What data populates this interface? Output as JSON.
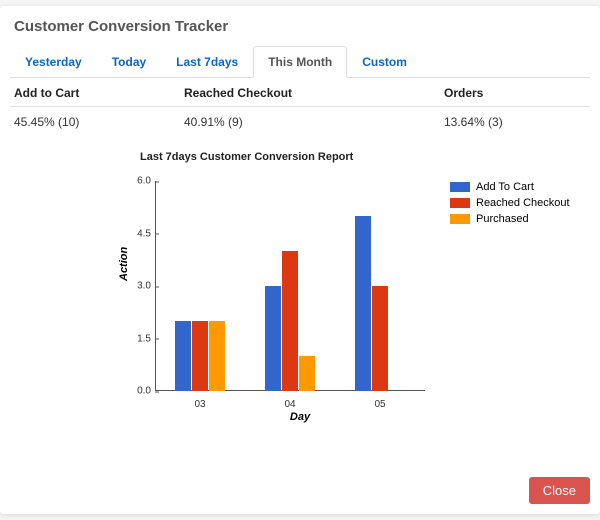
{
  "title": "Customer Conversion Tracker",
  "tabs": [
    "Yesterday",
    "Today",
    "Last 7days",
    "This Month",
    "Custom"
  ],
  "active_tab": 3,
  "metrics": {
    "headers": [
      "Add to Cart",
      "Reached Checkout",
      "Orders"
    ],
    "values": [
      "45.45% (10)",
      "40.91% (9)",
      "13.64% (3)"
    ]
  },
  "legend": [
    "Add To Cart",
    "Reached Checkout",
    "Purchased"
  ],
  "colors": {
    "add": "#3366cc",
    "reach": "#dc3912",
    "buy": "#ff9900",
    "close_btn": "#d9534f"
  },
  "close_label": "Close",
  "chart_data": {
    "type": "bar",
    "title": "Last 7days Customer Conversion Report",
    "xlabel": "Day",
    "ylabel": "Action",
    "ylim": [
      0.0,
      6.0
    ],
    "yticks": [
      0.0,
      1.5,
      3.0,
      4.5,
      6.0
    ],
    "categories": [
      "03",
      "04",
      "05"
    ],
    "series": [
      {
        "name": "Add To Cart",
        "color": "#3366cc",
        "values": [
          2.0,
          3.0,
          5.0
        ]
      },
      {
        "name": "Reached Checkout",
        "color": "#dc3912",
        "values": [
          2.0,
          4.0,
          3.0
        ]
      },
      {
        "name": "Purchased",
        "color": "#ff9900",
        "values": [
          2.0,
          1.0,
          0.0
        ]
      }
    ]
  }
}
